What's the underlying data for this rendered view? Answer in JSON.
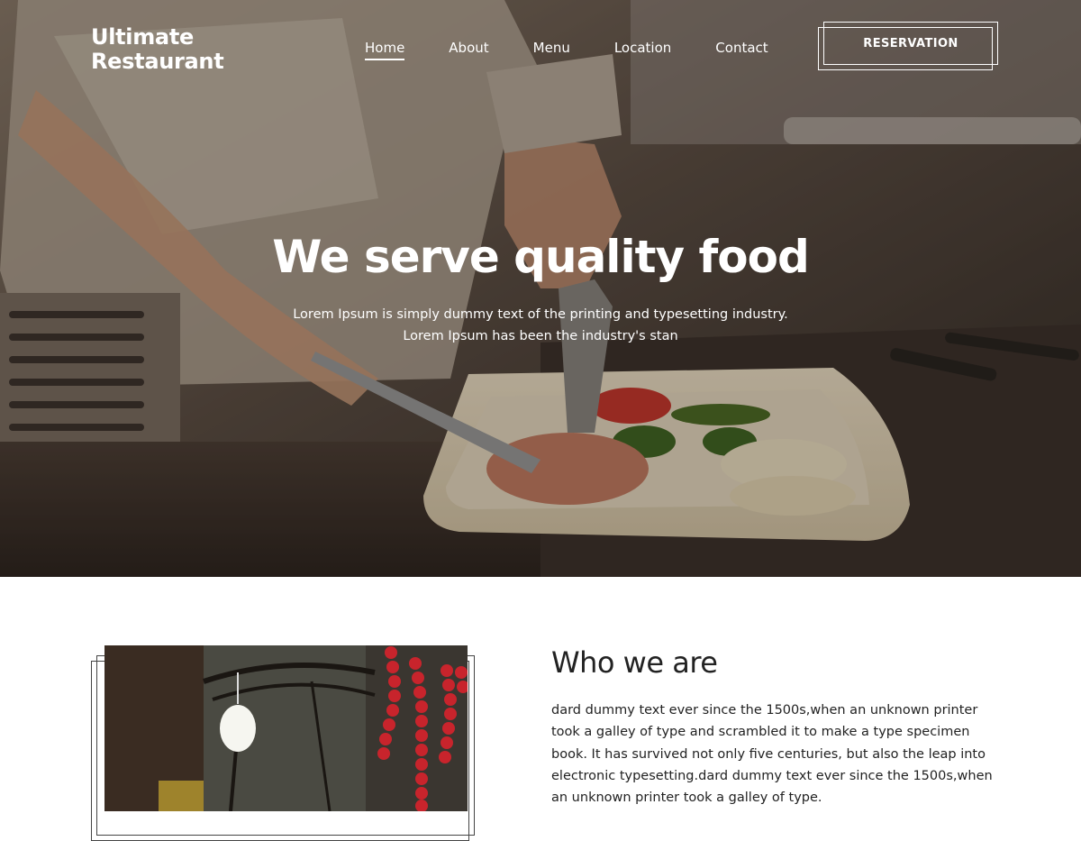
{
  "brand": {
    "line1": "Ultimate",
    "line2": "Restaurant"
  },
  "nav": {
    "items": [
      {
        "label": "Home",
        "active": true
      },
      {
        "label": "About",
        "active": false
      },
      {
        "label": "Menu",
        "active": false
      },
      {
        "label": "Location",
        "active": false
      },
      {
        "label": "Contact",
        "active": false
      }
    ]
  },
  "reservation": {
    "label": "RESERVATION"
  },
  "hero": {
    "title": "We serve quality food",
    "subtitle_line1": "Lorem Ipsum is simply dummy text of the printing and typesetting industry.",
    "subtitle_line2": "Lorem Ipsum has been the industry's stan",
    "image_icon": "chef-plating-photo"
  },
  "about": {
    "title": "Who we are",
    "text": "dard dummy text ever since the 1500s,when an unknown printer took a galley of type and scrambled it to make a type specimen book. It has survived not only five centuries, but also the leap into electronic typesetting.dard dummy text ever since the 1500s,when an unknown printer took a galley of type.",
    "image_icon": "restaurant-interior-photo"
  },
  "colors": {
    "text_dark": "#222222",
    "hero_text": "#ffffff",
    "accent_red": "#c8242c"
  }
}
